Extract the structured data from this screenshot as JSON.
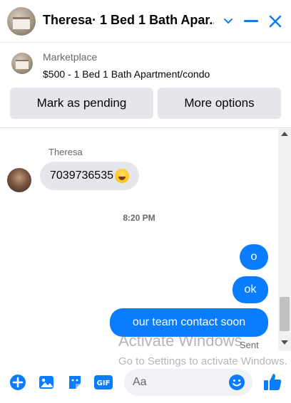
{
  "header": {
    "title": "Theresa· 1 Bed 1 Bath Apar...",
    "icons": [
      "listing-photo",
      "chevron-down-icon",
      "minimize-icon",
      "close-icon"
    ],
    "accent": "#0a7cff"
  },
  "marketplace": {
    "source": "Marketplace",
    "listing": "$500 - 1 Bed 1 Bath Apartment/condo",
    "buttons": {
      "pending": "Mark as pending",
      "more": "More options"
    }
  },
  "conversation": {
    "sender_name": "Theresa",
    "their_message": "7039736535",
    "timestamp": "8:20 PM",
    "my_messages": [
      "o",
      "ok",
      "our team contact  soon"
    ],
    "status": "Sent",
    "bubble_color": "#0a7cff"
  },
  "watermark": {
    "line1": "Activate Windows",
    "line2": "Go to Settings to activate Windows."
  },
  "composer": {
    "placeholder": "Aa",
    "icons": [
      "plus-icon",
      "photo-icon",
      "sticker-icon",
      "gif-icon",
      "emoji-icon",
      "like-icon"
    ]
  }
}
